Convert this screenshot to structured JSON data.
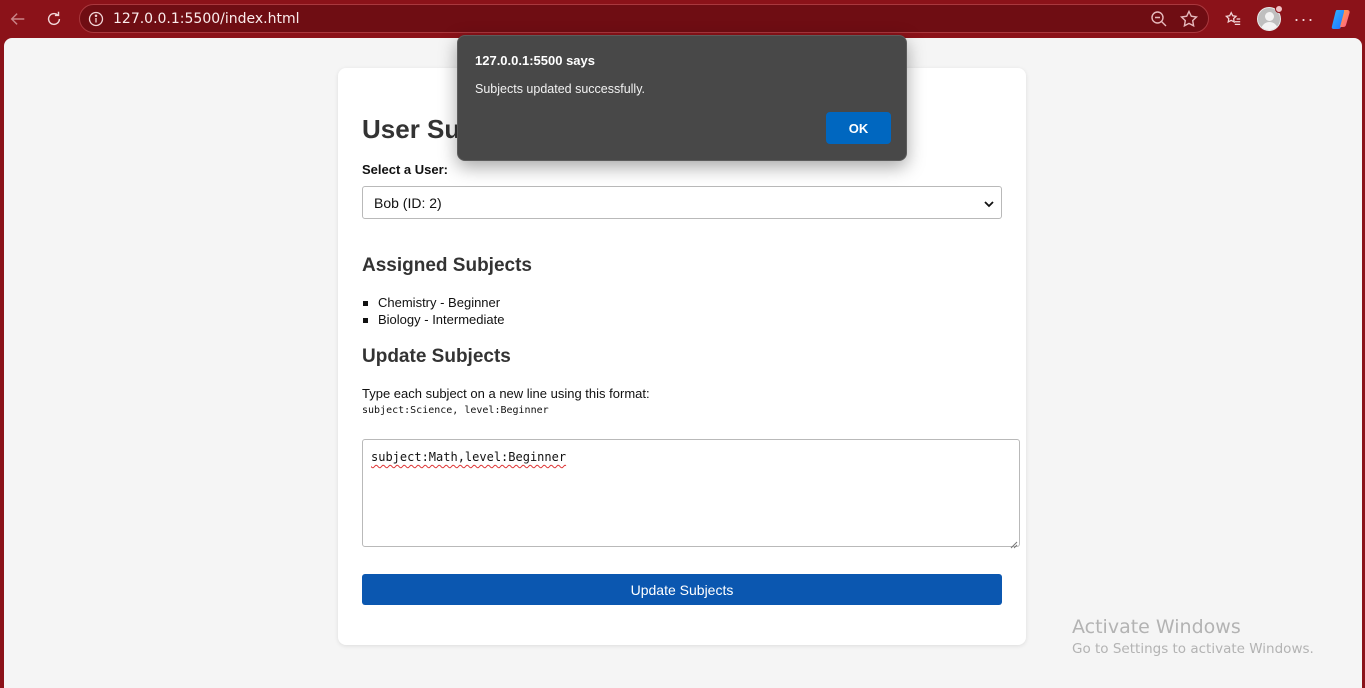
{
  "browser": {
    "url": "127.0.0.1:5500/index.html",
    "icons": [
      "back-arrow-icon",
      "reload-icon",
      "info-icon",
      "zoom-out-icon",
      "favorite-star-icon",
      "favorites-list-icon",
      "profile-avatar-icon",
      "more-options-icon",
      "copilot-icon"
    ]
  },
  "dialog": {
    "title": "127.0.0.1:5500 says",
    "message": "Subjects updated successfully.",
    "ok_label": "OK"
  },
  "page": {
    "title": "User Subjects",
    "select_label": "Select a User:",
    "selected_user": "Bob (ID: 2)",
    "assigned_heading": "Assigned Subjects",
    "assigned": [
      "Chemistry - Beginner",
      "Biology - Intermediate"
    ],
    "update_heading": "Update Subjects",
    "instructions": "Type each subject on a new line using this format:",
    "format_example": "subject:Science, level:Beginner",
    "textarea_value": "subject:Math,level:Beginner",
    "update_button": "Update Subjects"
  },
  "watermark": {
    "line1": "Activate Windows",
    "line2": "Go to Settings to activate Windows."
  },
  "colors": {
    "browser_frame": "#8b1219",
    "primary_button": "#0b57b0",
    "dialog_bg": "#484848",
    "dialog_ok": "#0067c0"
  }
}
